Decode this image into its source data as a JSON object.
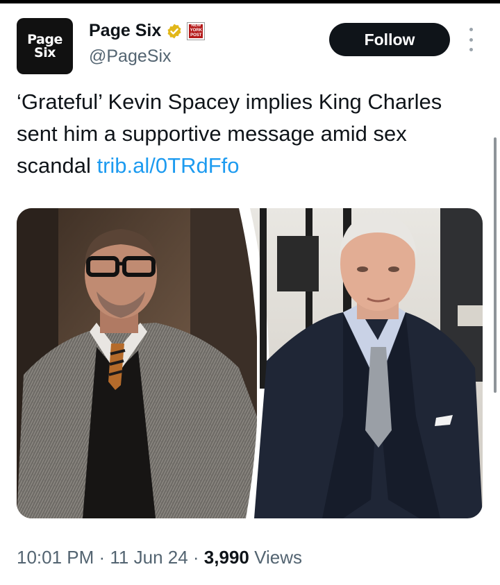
{
  "account": {
    "avatar_line1": "Page",
    "avatar_line2": "Six",
    "name": "Page Six",
    "handle": "@PageSix",
    "affiliate_badge_text": "NEW YORK POST",
    "verified_badge_icon": "verified-gold-badge-icon"
  },
  "actions": {
    "follow_label": "Follow",
    "more_icon": "more-vertical-icon"
  },
  "tweet": {
    "text": "‘Grateful’ Kevin Spacey implies King Charles sent him a supportive message amid sex scandal ",
    "link": "trib.al/0TRdFfo"
  },
  "media": {
    "left_photo": "man-with-glasses-herringbone-jacket",
    "right_photo": "older-man-navy-coat"
  },
  "meta": {
    "time": "10:01 PM",
    "separator1": " · ",
    "date": "11 Jun 24",
    "separator2": " · ",
    "views_count": "3,990",
    "views_label": " Views"
  },
  "colors": {
    "text": "#0f1419",
    "secondary": "#536471",
    "link": "#1d9bf0",
    "verified": "#e2b719"
  }
}
